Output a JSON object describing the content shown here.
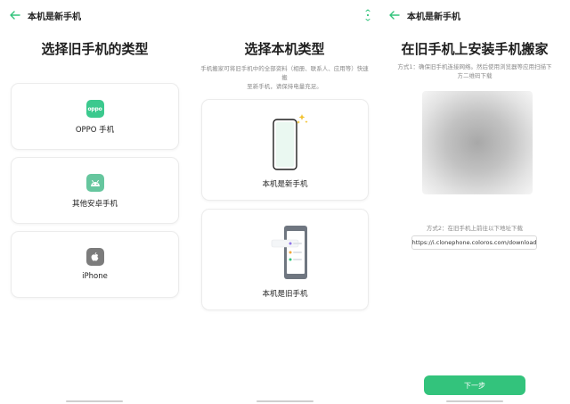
{
  "colors": {
    "accent": "#33c37c",
    "oppo": "#3bc98e",
    "android": "#66c69e",
    "apple": "#7c7c7c"
  },
  "panel1": {
    "title": "选择旧手机的类型",
    "options": [
      {
        "label": "OPPO 手机",
        "icon": "oppo-logo-icon",
        "icon_text": "oppo"
      },
      {
        "label": "其他安卓手机",
        "icon": "android-icon"
      },
      {
        "label": "iPhone",
        "icon": "apple-icon"
      }
    ]
  },
  "panel2": {
    "title": "选择本机类型",
    "subtitle_line1": "手机搬家可将旧手机中的全部资料（相册、联系人、应用等）快速搬",
    "subtitle_line2": "至新手机，请保持电量充足。",
    "options": [
      {
        "label": "本机是新手机",
        "icon": "new-phone-icon"
      },
      {
        "label": "本机是旧手机",
        "icon": "old-phone-icon"
      }
    ]
  },
  "panel3": {
    "header_title": "本机是新手机",
    "title": "在旧手机上安装手机搬家",
    "method1_line1": "方式1：确保旧手机连接网络。然后使用浏览器等应用扫描下",
    "method1_line2": "方二维码下载",
    "method2": "方式2：在旧手机上前往以下地址下载",
    "url": "https://i.clonephone.coloros.com/download",
    "next_label": "下一步"
  },
  "header": {
    "title": "本机是新手机"
  }
}
